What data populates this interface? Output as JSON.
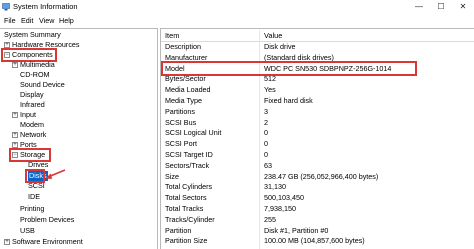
{
  "window": {
    "title": "System Information",
    "controls": {
      "minimize": "—",
      "maximize": "☐",
      "close": "✕"
    }
  },
  "menu": [
    "File",
    "Edit",
    "View",
    "Help"
  ],
  "tree": [
    {
      "label": "System Summary",
      "expander": "",
      "level": 0
    },
    {
      "label": "Hardware Resources",
      "expander": "+",
      "level": 1
    },
    {
      "label": "Components",
      "expander": "−",
      "level": 1,
      "highlighted": true
    },
    {
      "label": "Multimedia",
      "expander": "+",
      "level": 2
    },
    {
      "label": "CD-ROM",
      "expander": "",
      "level": 2
    },
    {
      "label": "Sound Device",
      "expander": "",
      "level": 2
    },
    {
      "label": "Display",
      "expander": "",
      "level": 2
    },
    {
      "label": "Infrared",
      "expander": "",
      "level": 2
    },
    {
      "label": "Input",
      "expander": "+",
      "level": 2
    },
    {
      "label": "Modem",
      "expander": "",
      "level": 2
    },
    {
      "label": "Network",
      "expander": "+",
      "level": 2
    },
    {
      "label": "Ports",
      "expander": "+",
      "level": 2
    },
    {
      "label": "Storage",
      "expander": "−",
      "level": 2,
      "highlighted": true
    },
    {
      "label": "Drives",
      "expander": "",
      "level": 3
    },
    {
      "label": "Disks",
      "expander": "",
      "level": 3,
      "selected": true
    },
    {
      "label": "SCSI",
      "expander": "",
      "level": 3
    },
    {
      "label": "IDE",
      "expander": "",
      "level": 3
    },
    {
      "label": "Printing",
      "expander": "",
      "level": 2
    },
    {
      "label": "Problem Devices",
      "expander": "",
      "level": 2
    },
    {
      "label": "USB",
      "expander": "",
      "level": 2
    },
    {
      "label": "Software Environment",
      "expander": "+",
      "level": 1
    }
  ],
  "table": {
    "headers": {
      "item": "Item",
      "value": "Value"
    },
    "rows": [
      {
        "item": "Description",
        "value": "Disk drive"
      },
      {
        "item": "Manufacturer",
        "value": "(Standard disk drives)"
      },
      {
        "item": "Model",
        "value": "WDC PC SN530 SDBPNPZ-256G-1014",
        "highlighted": true
      },
      {
        "item": "Bytes/Sector",
        "value": "512"
      },
      {
        "item": "Media Loaded",
        "value": "Yes"
      },
      {
        "item": "Media Type",
        "value": "Fixed hard disk"
      },
      {
        "item": "Partitions",
        "value": "3"
      },
      {
        "item": "SCSI Bus",
        "value": "2"
      },
      {
        "item": "SCSI Logical Unit",
        "value": "0"
      },
      {
        "item": "SCSI Port",
        "value": "0"
      },
      {
        "item": "SCSI Target ID",
        "value": "0"
      },
      {
        "item": "Sectors/Track",
        "value": "63"
      },
      {
        "item": "Size",
        "value": "238.47 GB (256,052,966,400 bytes)"
      },
      {
        "item": "Total Cylinders",
        "value": "31,130"
      },
      {
        "item": "Total Sectors",
        "value": "500,103,450"
      },
      {
        "item": "Total Tracks",
        "value": "7,938,150"
      },
      {
        "item": "Tracks/Cylinder",
        "value": "255"
      },
      {
        "item": "Partition",
        "value": "Disk #1, Partition #0"
      },
      {
        "item": "Partition Size",
        "value": "100.00 MB (104,857,600 bytes)"
      }
    ]
  },
  "colors": {
    "annotation_red": "#d93636",
    "selection_blue": "#0a64c8"
  }
}
